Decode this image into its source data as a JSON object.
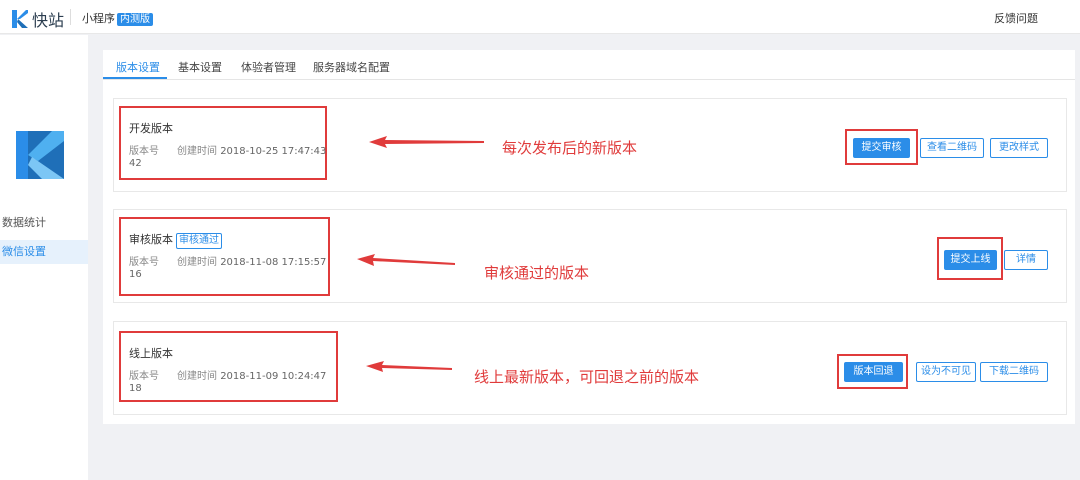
{
  "header": {
    "logo_text": "快站",
    "app_label": "小程序",
    "beta_badge": "内测版",
    "feedback": "反馈问题",
    "logo_icon": "k-logo-icon"
  },
  "sidebar": {
    "logo_icon": "k-logo-large-icon",
    "items": [
      {
        "label": "数据统计",
        "active": false
      },
      {
        "label": "微信设置",
        "active": true
      }
    ]
  },
  "tabs": [
    {
      "label": "版本设置",
      "active": true
    },
    {
      "label": "基本设置",
      "active": false
    },
    {
      "label": "体验者管理",
      "active": false
    },
    {
      "label": "服务器域名配置",
      "active": false
    }
  ],
  "versions": [
    {
      "title": "开发版本",
      "badge": "",
      "version_label": "版本号",
      "created_label": "创建时间",
      "created_time": "2018-10-25 17:47:43",
      "version_number": "42",
      "annotation": "每次发布后的新版本",
      "buttons": [
        "提交审核",
        "查看二维码",
        "更改样式"
      ]
    },
    {
      "title": "审核版本",
      "badge": "审核通过",
      "version_label": "版本号",
      "created_label": "创建时间",
      "created_time": "2018-11-08 17:15:57",
      "version_number": "16",
      "annotation": "审核通过的版本",
      "buttons": [
        "提交上线",
        "详情"
      ]
    },
    {
      "title": "线上版本",
      "badge": "",
      "version_label": "版本号",
      "created_label": "创建时间",
      "created_time": "2018-11-09 10:24:47",
      "version_number": "18",
      "annotation": "线上最新版本，可回退之前的版本",
      "buttons": [
        "版本回退",
        "设为不可见",
        "下载二维码"
      ]
    }
  ],
  "colors": {
    "accent": "#2b8de8",
    "annotation_red": "#e03b3b",
    "page_bg": "#f0f1f4"
  }
}
